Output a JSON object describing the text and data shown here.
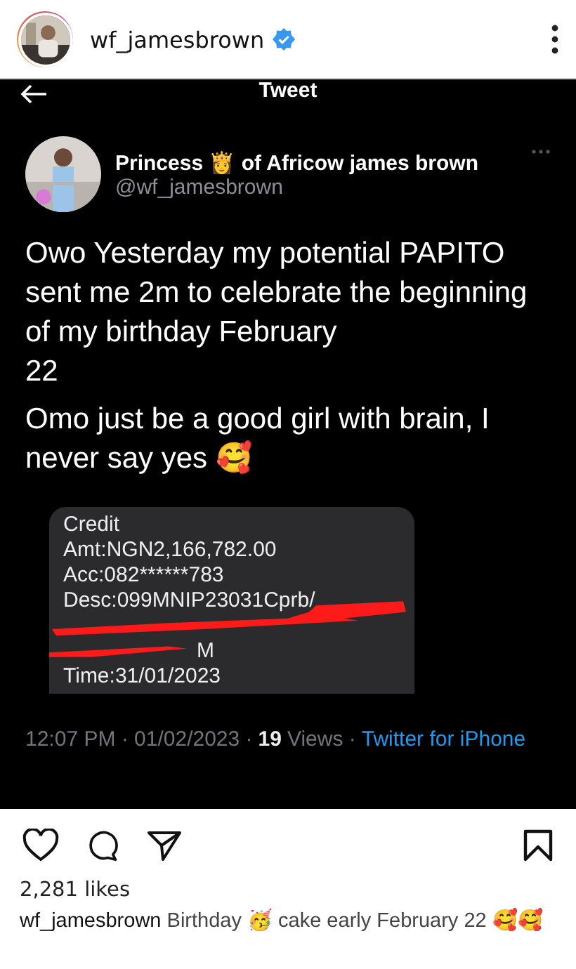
{
  "post_header": {
    "username": "wf_jamesbrown",
    "verified": true
  },
  "tweet": {
    "title": "Tweet",
    "author_name": "Princess 👸 of Africow james brown",
    "handle": "@wf_jamesbrown",
    "paragraphs": [
      "Owo Yesterday my potential PAPITO sent me 2m to celebrate the beginning of my birthday February\n22",
      "Omo just be a good girl with brain, I never say yes 🥰"
    ],
    "sms_lines": [
      "Credit",
      "Amt:NGN2,166,782.00",
      "Acc:082******783",
      "Desc:099MNIP23031Cprb/"
    ],
    "sms_fragment": "M",
    "sms_time": "Time:31/01/2023",
    "meta": {
      "time": "12:07 PM · 01/02/2023 ·",
      "views_count": "19",
      "views_label": "Views ·",
      "source": "Twitter for iPhone"
    }
  },
  "likes": "2,281 likes",
  "caption": {
    "username": "wf_jamesbrown",
    "text": "Birthday 🥳 cake early February 22 🥰🥰"
  }
}
